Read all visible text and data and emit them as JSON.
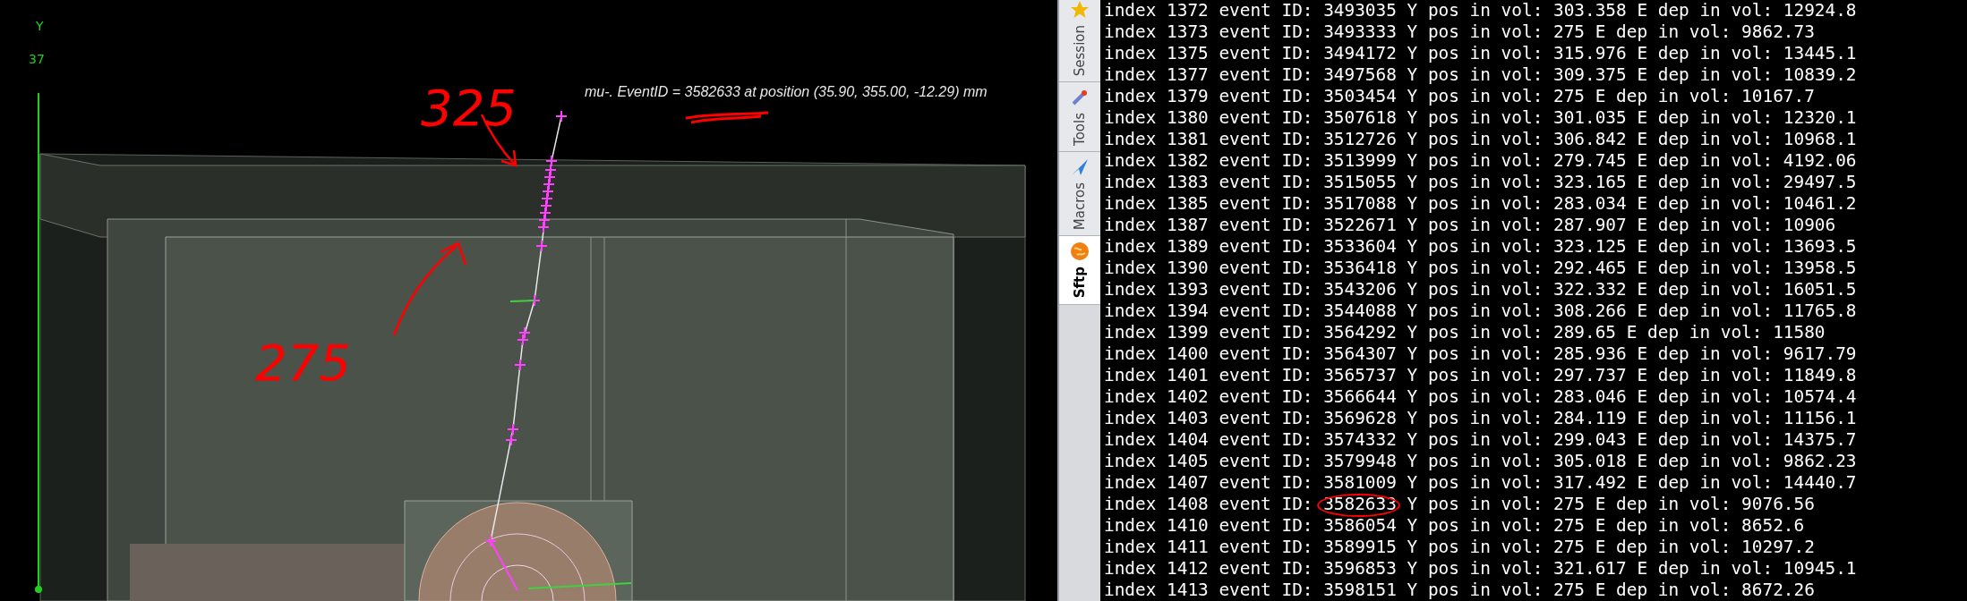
{
  "viewer": {
    "axis_label": "Y",
    "axis_value": "37",
    "caption": "mu-. EventID = 3582633 at position (35.90, 355.00, -12.29) mm",
    "annotations": [
      {
        "text": "325"
      },
      {
        "text": "275"
      }
    ]
  },
  "side_tabs": [
    {
      "label": "Session",
      "selected": false
    },
    {
      "label": "Tools",
      "selected": false
    },
    {
      "label": "Macros",
      "selected": false
    },
    {
      "label": "Sftp",
      "selected": true
    }
  ],
  "terminal": {
    "lines": [
      {
        "text": "index 1372 event ID: 3493035 Y pos in vol: 303.358 E dep in vol: 12924.8",
        "circled": false
      },
      {
        "text": "index 1373 event ID: 3493333 Y pos in vol: 275 E dep in vol: 9862.73",
        "circled": false
      },
      {
        "text": "index 1375 event ID: 3494172 Y pos in vol: 315.976 E dep in vol: 13445.1",
        "circled": false
      },
      {
        "text": "index 1377 event ID: 3497568 Y pos in vol: 309.375 E dep in vol: 10839.2",
        "circled": false
      },
      {
        "text": "index 1379 event ID: 3503454 Y pos in vol: 275 E dep in vol: 10167.7",
        "circled": false
      },
      {
        "text": "index 1380 event ID: 3507618 Y pos in vol: 301.035 E dep in vol: 12320.1",
        "circled": false
      },
      {
        "text": "index 1381 event ID: 3512726 Y pos in vol: 306.842 E dep in vol: 10968.1",
        "circled": false
      },
      {
        "text": "index 1382 event ID: 3513999 Y pos in vol: 279.745 E dep in vol: 4192.06",
        "circled": false
      },
      {
        "text": "index 1383 event ID: 3515055 Y pos in vol: 323.165 E dep in vol: 29497.5",
        "circled": false
      },
      {
        "text": "index 1385 event ID: 3517088 Y pos in vol: 283.034 E dep in vol: 10461.2",
        "circled": false
      },
      {
        "text": "index 1387 event ID: 3522671 Y pos in vol: 287.907 E dep in vol: 10906",
        "circled": false
      },
      {
        "text": "index 1389 event ID: 3533604 Y pos in vol: 323.125 E dep in vol: 13693.5",
        "circled": false
      },
      {
        "text": "index 1390 event ID: 3536418 Y pos in vol: 292.465 E dep in vol: 13958.5",
        "circled": false
      },
      {
        "text": "index 1393 event ID: 3543206 Y pos in vol: 322.332 E dep in vol: 16051.5",
        "circled": false
      },
      {
        "text": "index 1394 event ID: 3544088 Y pos in vol: 308.266 E dep in vol: 11765.8",
        "circled": false
      },
      {
        "text": "index 1399 event ID: 3564292 Y pos in vol: 289.65 E dep in vol: 11580",
        "circled": false
      },
      {
        "text": "index 1400 event ID: 3564307 Y pos in vol: 285.936 E dep in vol: 9617.79",
        "circled": false
      },
      {
        "text": "index 1401 event ID: 3565737 Y pos in vol: 297.737 E dep in vol: 11849.8",
        "circled": false
      },
      {
        "text": "index 1402 event ID: 3566644 Y pos in vol: 283.046 E dep in vol: 10574.4",
        "circled": false
      },
      {
        "text": "index 1403 event ID: 3569628 Y pos in vol: 284.119 E dep in vol: 11156.1",
        "circled": false
      },
      {
        "text": "index 1404 event ID: 3574332 Y pos in vol: 299.043 E dep in vol: 14375.7",
        "circled": false
      },
      {
        "text": "index 1405 event ID: 3579948 Y pos in vol: 305.018 E dep in vol: 9862.23",
        "circled": false
      },
      {
        "text": "index 1407 event ID: 3581009 Y pos in vol: 317.492 E dep in vol: 14440.7",
        "circled": false
      },
      {
        "text": "index 1408 event ID: 3582633 Y pos in vol: 275 E dep in vol: 9076.56",
        "circled": true
      },
      {
        "text": "index 1410 event ID: 3586054 Y pos in vol: 275 E dep in vol: 8652.6",
        "circled": false
      },
      {
        "text": "index 1411 event ID: 3589915 Y pos in vol: 275 E dep in vol: 10297.2",
        "circled": false
      },
      {
        "text": "index 1412 event ID: 3596853 Y pos in vol: 321.617 E dep in vol: 10945.1",
        "circled": false
      },
      {
        "text": "index 1413 event ID: 3598151 Y pos in vol: 275 E dep in vol: 8672.26",
        "circled": false
      }
    ]
  }
}
